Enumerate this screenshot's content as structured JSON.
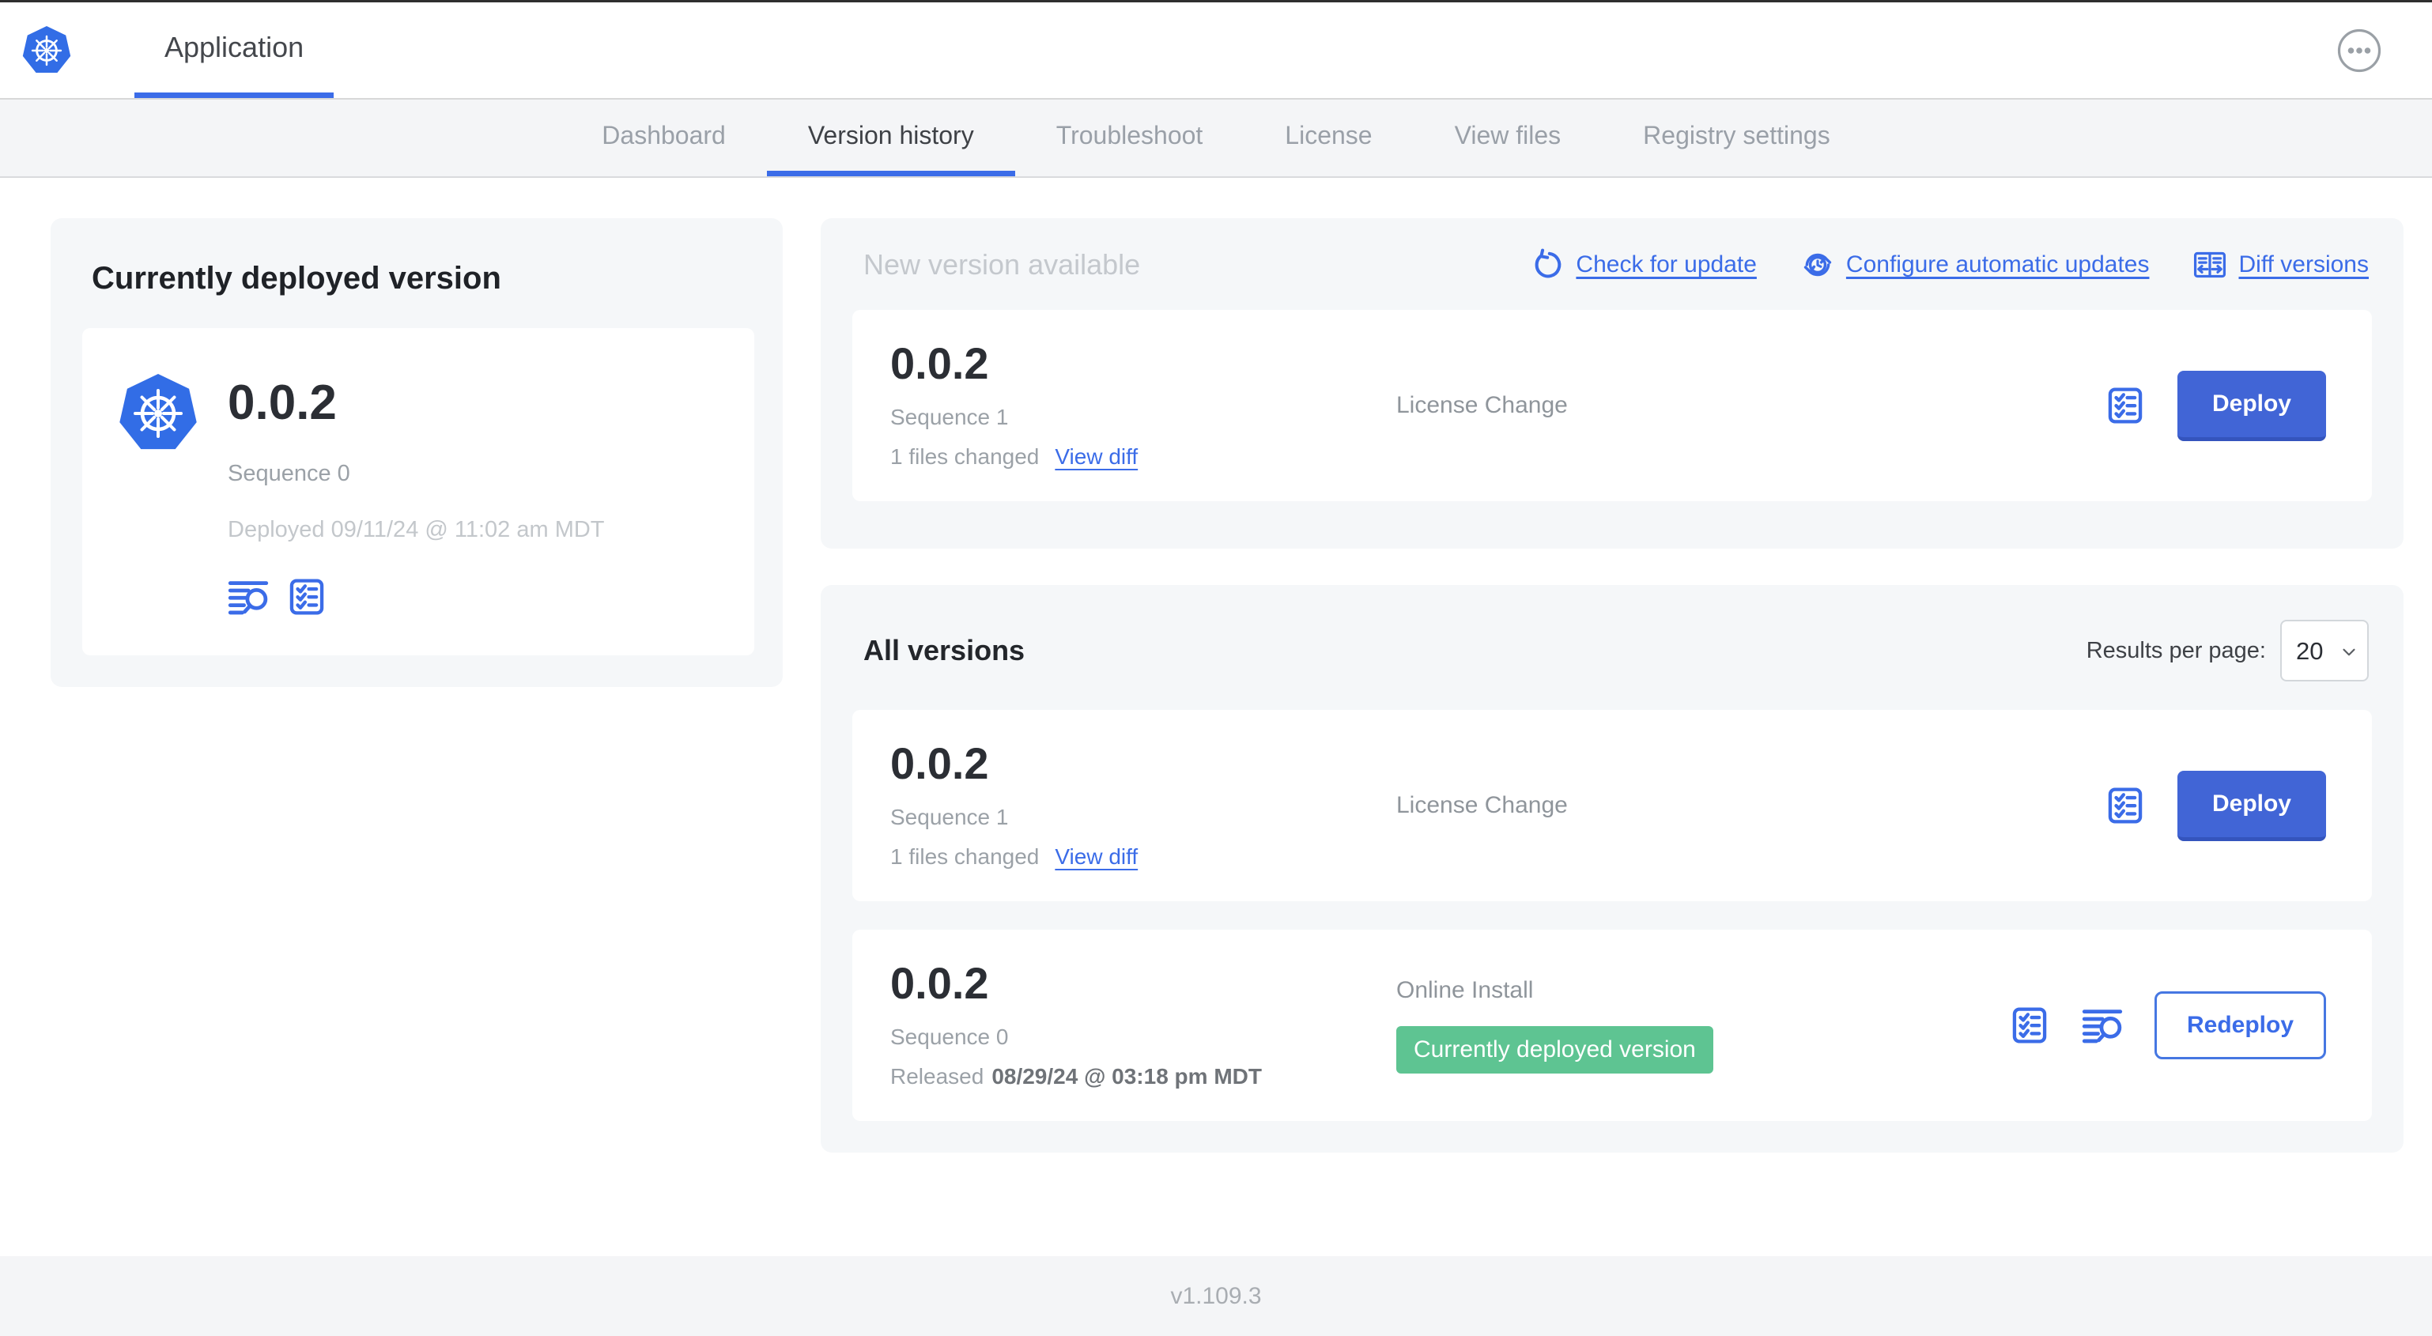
{
  "header": {
    "app_tab_label": "Application"
  },
  "nav": {
    "active_tab": "Version history",
    "tabs": [
      {
        "label": "Dashboard"
      },
      {
        "label": "Version history"
      },
      {
        "label": "Troubleshoot"
      },
      {
        "label": "License"
      },
      {
        "label": "View files"
      },
      {
        "label": "Registry settings"
      }
    ]
  },
  "current_version": {
    "title": "Currently deployed version",
    "version": "0.0.2",
    "sequence": "Sequence 0",
    "deployed": "Deployed 09/11/24 @ 11:02 am MDT"
  },
  "new_version": {
    "title": "New version available",
    "actions": {
      "check_for_update": "Check for update",
      "configure_automatic_updates": "Configure automatic updates",
      "diff_versions": "Diff versions"
    },
    "card": {
      "version": "0.0.2",
      "sequence": "Sequence 1",
      "files_changed": "1 files changed",
      "view_diff": "View diff",
      "release_notes": "License Change",
      "action_label": "Deploy"
    }
  },
  "all_versions": {
    "title": "All versions",
    "results_per_page_label": "Results per page:",
    "results_per_page_value": "20",
    "rows": [
      {
        "version": "0.0.2",
        "sequence": "Sequence 1",
        "files_changed": "1 files changed",
        "view_diff": "View diff",
        "release_notes": "License Change",
        "action_label": "Deploy"
      },
      {
        "version": "0.0.2",
        "sequence": "Sequence 0",
        "released_label": "Released",
        "released_date": "08/29/24 @ 03:18 pm MDT",
        "install_type": "Online Install",
        "badge": "Currently deployed version",
        "action_label": "Redeploy"
      }
    ]
  },
  "footer": {
    "app_version": "v1.109.3"
  },
  "colors": {
    "accent_blue": "#3b6ce8",
    "kubernetes_blue": "#326de6",
    "deploy_button_blue": "#4165d6",
    "badge_green": "#5ec492",
    "panel_gray": "#f5f7f9",
    "nav_gray": "#f4f5f7"
  }
}
